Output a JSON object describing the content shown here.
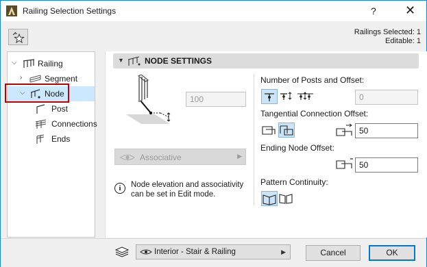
{
  "window": {
    "title": "Railing Selection Settings",
    "help_glyph": "?",
    "close_glyph": "✕"
  },
  "selection": {
    "selected_text": "Railings Selected: 1",
    "editable_text": "Editable: 1"
  },
  "tree": {
    "items": [
      {
        "label": "Railing",
        "icon": "railing-icon",
        "expanded": true
      },
      {
        "label": "Segment",
        "icon": "segment-icon",
        "expanded": false
      },
      {
        "label": "Node",
        "icon": "node-icon",
        "expanded": true,
        "selected": true
      },
      {
        "label": "Post",
        "icon": "post-icon"
      },
      {
        "label": "Connections",
        "icon": "connections-icon"
      },
      {
        "label": "Ends",
        "icon": "ends-icon"
      }
    ]
  },
  "section": {
    "title": "NODE SETTINGS"
  },
  "elevation_field": {
    "value": "100"
  },
  "associative": {
    "label": "Associative"
  },
  "info": {
    "text": "Node elevation and associativity can be set in Edit mode."
  },
  "posts": {
    "label": "Number of Posts and Offset:",
    "value": "0"
  },
  "tangential": {
    "label": "Tangential Connection Offset:",
    "value": "50"
  },
  "ending": {
    "label": "Ending Node Offset:",
    "value": "50"
  },
  "pattern": {
    "label": "Pattern Continuity:"
  },
  "layer": {
    "label": "Interior - Stair & Railing"
  },
  "buttons": {
    "cancel": "Cancel",
    "ok": "OK"
  },
  "colors": {
    "accent": "#0078d7",
    "selection": "#cce8ff",
    "highlight_outline": "#c00000",
    "header_bg": "#dcdcdc"
  }
}
